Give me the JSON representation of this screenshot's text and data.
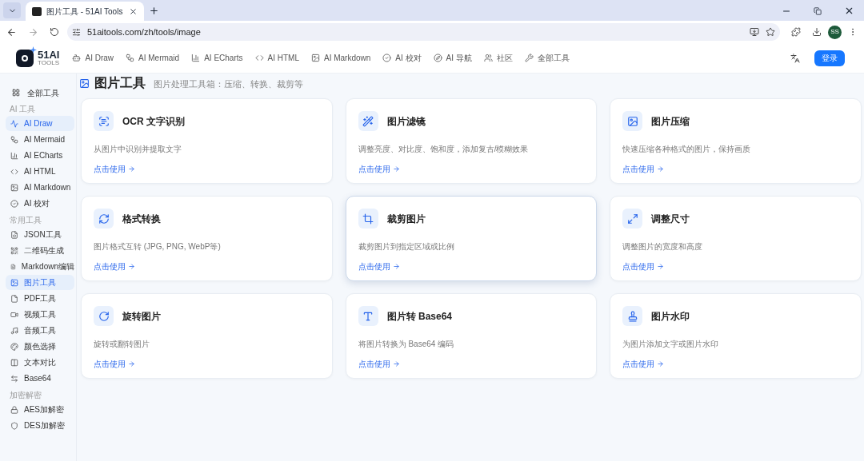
{
  "browser": {
    "tab_title": "图片工具 - 51AI Tools",
    "url": "51aitools.com/zh/tools/image",
    "profile": "SS"
  },
  "header": {
    "logo_title": "51AI",
    "logo_subtitle": "TOOLS",
    "nav": [
      {
        "label": "AI Draw"
      },
      {
        "label": "AI Mermaid"
      },
      {
        "label": "AI ECharts"
      },
      {
        "label": "AI HTML"
      },
      {
        "label": "AI Markdown"
      },
      {
        "label": "AI 校对"
      },
      {
        "label": "AI 导航"
      },
      {
        "label": "社区"
      },
      {
        "label": "全部工具"
      }
    ],
    "login": "登录"
  },
  "sidebar": {
    "all_tools": "全部工具",
    "sections": [
      {
        "title": "AI 工具",
        "items": [
          {
            "label": "AI Draw",
            "selected": true
          },
          {
            "label": "AI Mermaid",
            "selected": false
          },
          {
            "label": "AI ECharts",
            "selected": false
          },
          {
            "label": "AI HTML",
            "selected": false
          },
          {
            "label": "AI Markdown",
            "selected": false
          },
          {
            "label": "AI 校对",
            "selected": false
          }
        ]
      },
      {
        "title": "常用工具",
        "items": [
          {
            "label": "JSON工具",
            "selected": false
          },
          {
            "label": "二维码生成",
            "selected": false
          },
          {
            "label": "Markdown编辑",
            "selected": false
          },
          {
            "label": "图片工具",
            "selected": true
          },
          {
            "label": "PDF工具",
            "selected": false
          },
          {
            "label": "视频工具",
            "selected": false
          },
          {
            "label": "音频工具",
            "selected": false
          },
          {
            "label": "颜色选择",
            "selected": false
          },
          {
            "label": "文本对比",
            "selected": false
          },
          {
            "label": "Base64",
            "selected": false
          }
        ]
      },
      {
        "title": "加密解密",
        "items": [
          {
            "label": "AES加解密",
            "selected": false
          },
          {
            "label": "DES加解密",
            "selected": false
          }
        ]
      }
    ]
  },
  "page": {
    "title": "图片工具",
    "subtitle": "图片处理工具箱：压缩、转换、裁剪等"
  },
  "cards": [
    {
      "title": "OCR 文字识别",
      "description": "从图片中识别并提取文字",
      "link": "点击使用",
      "hovered": false
    },
    {
      "title": "图片滤镜",
      "description": "调整亮度、对比度、饱和度，添加复古/模糊效果",
      "link": "点击使用",
      "hovered": false
    },
    {
      "title": "图片压缩",
      "description": "快速压缩各种格式的图片，保持画质",
      "link": "点击使用",
      "hovered": false
    },
    {
      "title": "格式转换",
      "description": "图片格式互转 (JPG, PNG, WebP等)",
      "link": "点击使用",
      "hovered": false
    },
    {
      "title": "裁剪图片",
      "description": "裁剪图片到指定区域或比例",
      "link": "点击使用",
      "hovered": true
    },
    {
      "title": "调整尺寸",
      "description": "调整图片的宽度和高度",
      "link": "点击使用",
      "hovered": false
    },
    {
      "title": "旋转图片",
      "description": "旋转或翻转图片",
      "link": "点击使用",
      "hovered": false
    },
    {
      "title": "图片转 Base64",
      "description": "将图片转换为 Base64 编码",
      "link": "点击使用",
      "hovered": false
    },
    {
      "title": "图片水印",
      "description": "为图片添加文字或图片水印",
      "link": "点击使用",
      "hovered": false
    }
  ]
}
